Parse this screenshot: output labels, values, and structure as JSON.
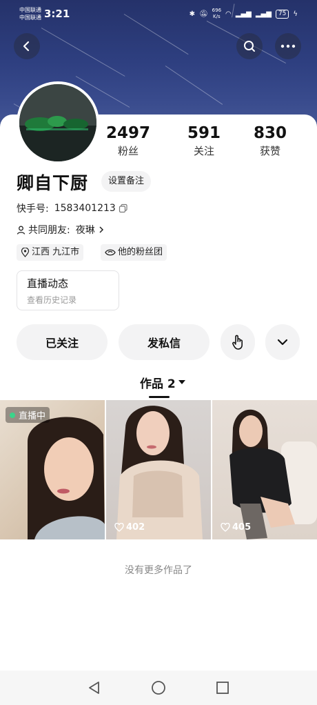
{
  "status_bar": {
    "carrier_1": "中国联通",
    "carrier_2": "中国联通",
    "time": "3:21",
    "net_speed_value": "696",
    "net_speed_unit": "K/s",
    "battery": "75"
  },
  "profile": {
    "followers_count": "2497",
    "followers_label": "粉丝",
    "following_count": "591",
    "following_label": "关注",
    "likes_count": "830",
    "likes_label": "获赞",
    "name": "卿自下厨",
    "set_remark_label": "设置备注",
    "kuaishou_id_label": "快手号:",
    "kuaishou_id": "1583401213",
    "mutual_friends_label": "共同朋友:",
    "mutual_friends_name": "夜琳",
    "location": "江西 九江市",
    "fan_group": "他的粉丝团"
  },
  "live_card": {
    "title": "直播动态",
    "subtitle": "查看历史记录"
  },
  "actions": {
    "following_label": "已关注",
    "message_label": "发私信"
  },
  "works": {
    "tab_label": "作品 2",
    "live_badge": "直播中",
    "items": [
      {
        "likes": ""
      },
      {
        "likes": "402"
      },
      {
        "likes": "405"
      }
    ],
    "footer": "没有更多作品了"
  },
  "icons": [
    "back-icon",
    "search-icon",
    "more-icon",
    "copy-icon",
    "person-icon",
    "chevron-right-icon",
    "location-icon",
    "fan-group-icon",
    "share-gesture-icon",
    "chevron-down-icon",
    "heart-icon",
    "nav-back-icon",
    "nav-home-icon",
    "nav-recents-icon"
  ]
}
